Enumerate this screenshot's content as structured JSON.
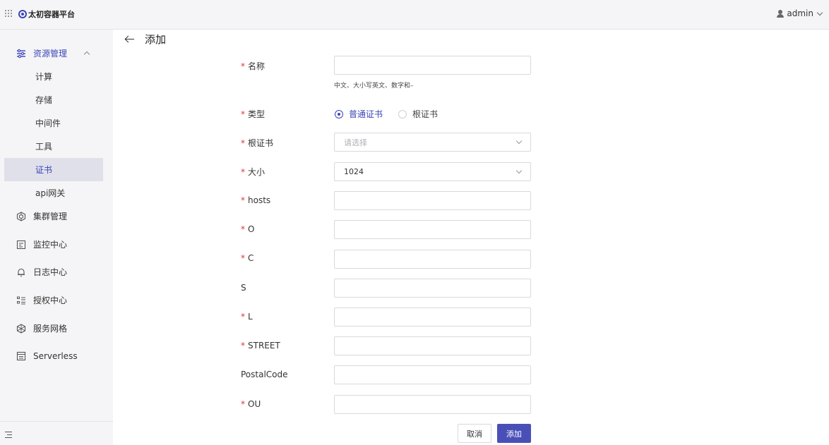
{
  "header": {
    "logo_text": "太初容器平台",
    "user_name": "admin"
  },
  "sidebar": {
    "group": {
      "label": "资源管理",
      "expanded": true
    },
    "sub_items": [
      {
        "label": "计算"
      },
      {
        "label": "存储"
      },
      {
        "label": "中间件"
      },
      {
        "label": "工具"
      },
      {
        "label": "证书",
        "selected": true
      },
      {
        "label": "api网关"
      }
    ],
    "items": [
      {
        "label": "集群管理",
        "icon": "cluster-icon"
      },
      {
        "label": "监控中心",
        "icon": "monitor-icon"
      },
      {
        "label": "日志中心",
        "icon": "bell-icon"
      },
      {
        "label": "授权中心",
        "icon": "list-icon"
      },
      {
        "label": "服务网格",
        "icon": "mesh-icon"
      },
      {
        "label": "Serverless",
        "icon": "serverless-icon"
      }
    ]
  },
  "page": {
    "title": "添加"
  },
  "form": {
    "name": {
      "label": "名称",
      "required": true,
      "value": "",
      "hint": "中文、大小写英文、数字和–"
    },
    "type": {
      "label": "类型",
      "required": true,
      "options": [
        "普通证书",
        "根证书"
      ],
      "selected": "普通证书"
    },
    "root_cert": {
      "label": "根证书",
      "required": true,
      "placeholder": "请选择"
    },
    "size": {
      "label": "大小",
      "required": true,
      "value": "1024"
    },
    "hosts": {
      "label": "hosts",
      "required": true,
      "value": ""
    },
    "o": {
      "label": "O",
      "required": true,
      "value": ""
    },
    "c": {
      "label": "C",
      "required": true,
      "value": ""
    },
    "s": {
      "label": "S",
      "required": false,
      "value": ""
    },
    "l": {
      "label": "L",
      "required": true,
      "value": ""
    },
    "street": {
      "label": "STREET",
      "required": true,
      "value": ""
    },
    "postal_code": {
      "label": "PostalCode",
      "required": false,
      "value": ""
    },
    "ou": {
      "label": "OU",
      "required": true,
      "value": ""
    },
    "required_mark": "*"
  },
  "actions": {
    "cancel_label": "取消",
    "submit_label": "添加"
  },
  "colors": {
    "accent": "#3a46b8",
    "primary_button": "#4a4fb8",
    "required": "#d9363e"
  }
}
